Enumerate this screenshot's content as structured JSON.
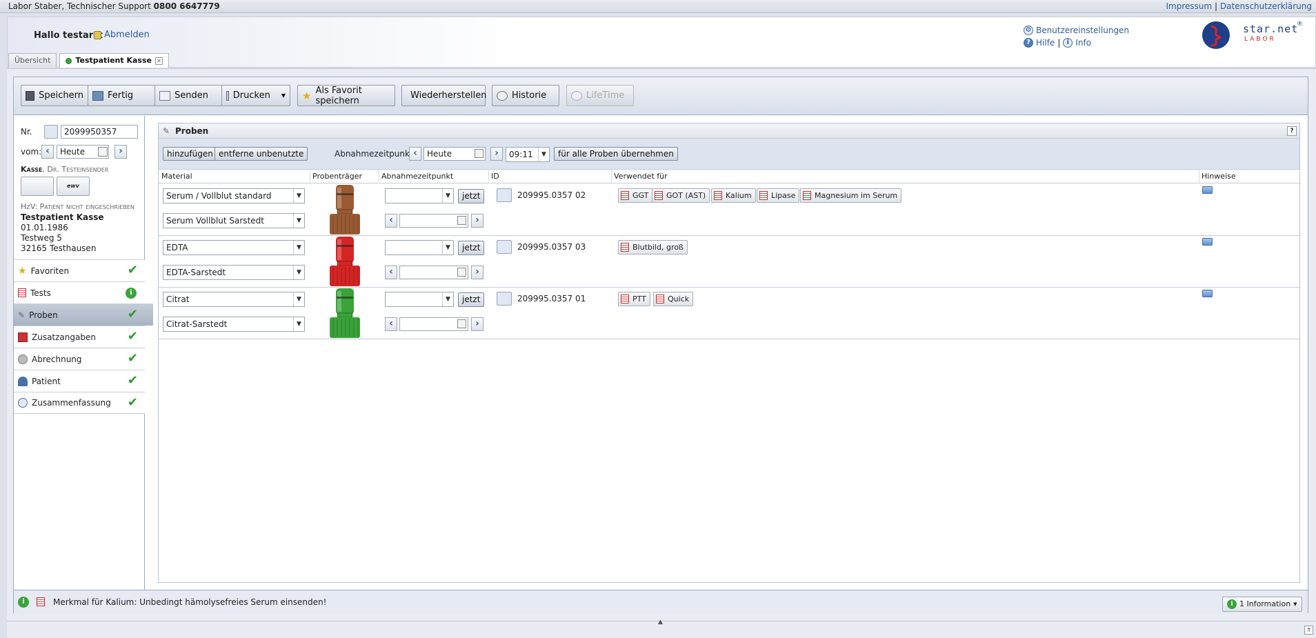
{
  "topbar": {
    "support_label": "Labor Staber, Technischer Support",
    "support_phone": "0800 6647779",
    "impressum": "Impressum",
    "divider": "|",
    "datenschutz": "Datenschutzerklärung"
  },
  "header": {
    "greeting": "Hallo testarzt",
    "logout": "Abmelden",
    "settings": "Benutzereinstellungen",
    "help": "Hilfe",
    "help_sep": "|",
    "info": "Info",
    "logo_text": "star.net",
    "logo_sub": "LABOR",
    "logo_reg": "®"
  },
  "tabs": [
    {
      "label": "Übersicht"
    },
    {
      "label": "Testpatient Kasse"
    }
  ],
  "toolbar": {
    "save": "Speichern",
    "done": "Fertig",
    "send": "Senden",
    "print": "Drucken",
    "favorite": "Als Favorit speichern",
    "restore": "Wiederherstellen",
    "history": "Historie",
    "lifetime": "LifeTime"
  },
  "left": {
    "nr_label": "Nr.",
    "nr_value": "2099950357",
    "vom_label": "vom:",
    "vom_value": "Heute",
    "sender_name": "Kasse",
    "sender_detail": ", Dr. Testeinsender",
    "ewv_label": "ewv",
    "insurance": "HzV: Patient nicht eingeschrieben",
    "patient_name": "Testpatient Kasse",
    "dob": "01.01.1986",
    "street": "Testweg 5",
    "city": "32165 Testhausen"
  },
  "nav": [
    {
      "label": "Favoriten",
      "status": "check"
    },
    {
      "label": "Tests",
      "status": "info"
    },
    {
      "label": "Proben",
      "status": "check"
    },
    {
      "label": "Zusatzangaben",
      "status": "check"
    },
    {
      "label": "Abrechnung",
      "status": "check"
    },
    {
      "label": "Patient",
      "status": "check"
    },
    {
      "label": "Zusammenfassung",
      "status": "check"
    }
  ],
  "proben": {
    "title": "Proben",
    "help": "?",
    "add": "hinzufügen",
    "remove_unused": "entferne unbenutzte",
    "time_label": "Abnahmezeitpunkt:",
    "date_value": "Heute",
    "time_value": "09:11",
    "apply_all": "für alle Proben übernehmen",
    "columns": {
      "material": "Material",
      "carrier": "Probenträger",
      "time": "Abnahmezeitpunkt",
      "id": "ID",
      "used": "Verwendet für",
      "notes": "Hinweise"
    },
    "now_label": "jetzt",
    "rows": [
      {
        "material": "Serum / Vollblut standard",
        "container": "Serum Vollblut Sarstedt",
        "id": "209995.0357 02",
        "color": "#9a5b34",
        "tests": [
          "GGT",
          "GOT (AST)",
          "Kalium",
          "Lipase",
          "Magnesium im Serum"
        ]
      },
      {
        "material": "EDTA",
        "container": "EDTA-Sarstedt",
        "id": "209995.0357 03",
        "color": "#d42525",
        "tests": [
          "Blutbild, groß"
        ]
      },
      {
        "material": "Citrat",
        "container": "Citrat-Sarstedt",
        "id": "209995.0357 01",
        "color": "#3aa33a",
        "tests": [
          "PTT",
          "Quick"
        ]
      }
    ]
  },
  "status": {
    "message": "Merkmal für Kalium: Unbedingt hämolysefreies Serum einsenden!",
    "info_button": "1 Information"
  }
}
